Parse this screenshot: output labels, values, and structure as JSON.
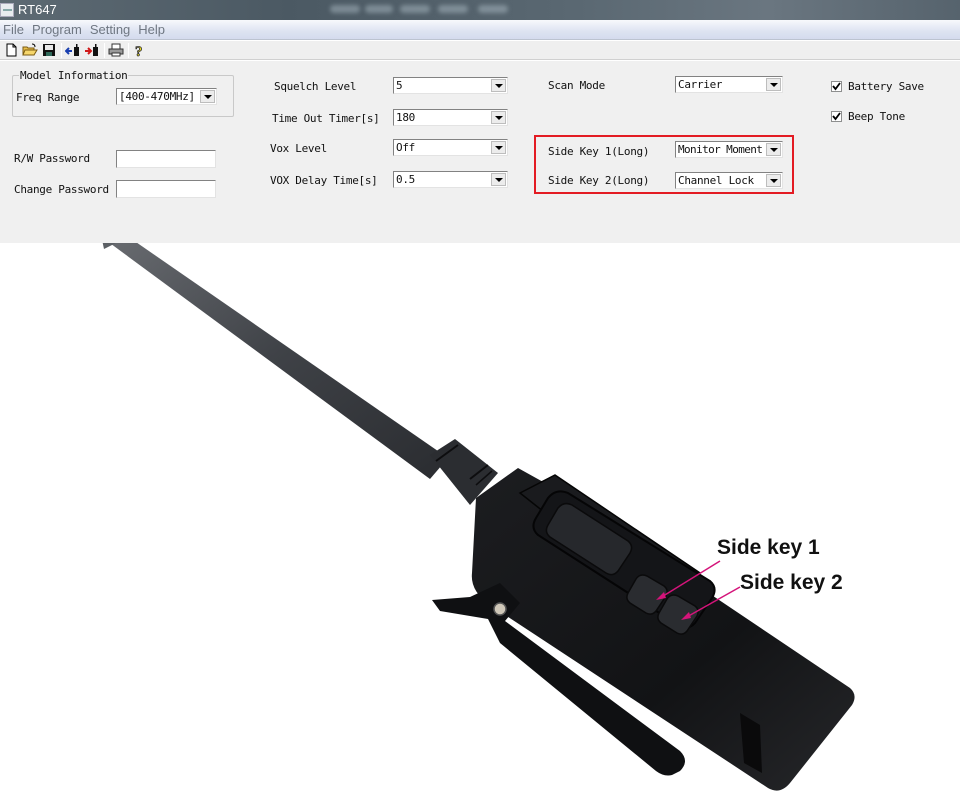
{
  "window": {
    "title": "RT647"
  },
  "menu": {
    "items": [
      "File",
      "Program",
      "Setting",
      "Help"
    ]
  },
  "toolbar": {
    "buttons": [
      "new-file",
      "open-folder",
      "save",
      "read-from-radio",
      "write-to-radio",
      "print",
      "help"
    ]
  },
  "model_info": {
    "group_title": "Model Information",
    "freq_range_label": "Freq Range",
    "freq_range_value": "[400-470MHz]"
  },
  "passwords": {
    "rw_label": "R/W Password",
    "rw_value": "",
    "change_label": "Change Password",
    "change_value": ""
  },
  "settings": {
    "squelch_label": "Squelch Level",
    "squelch_value": "5",
    "tot_label": "Time Out Timer[s]",
    "tot_value": "180",
    "vox_label": "Vox Level",
    "vox_value": "Off",
    "vox_delay_label": "VOX Delay Time[s]",
    "vox_delay_value": "0.5",
    "scan_mode_label": "Scan Mode",
    "scan_mode_value": "Carrier",
    "side_key1_label": "Side Key 1(Long)",
    "side_key1_value": "Monitor Moment",
    "side_key2_label": "Side Key 2(Long)",
    "side_key2_value": "Channel Lock",
    "battery_save_label": "Battery Save",
    "battery_save_checked": true,
    "beep_tone_label": "Beep Tone",
    "beep_tone_checked": true
  },
  "photo": {
    "callout_1": "Side key 1",
    "callout_2": "Side key 2",
    "highlight_color": "#e31b23",
    "arrow_color": "#d4147a"
  }
}
